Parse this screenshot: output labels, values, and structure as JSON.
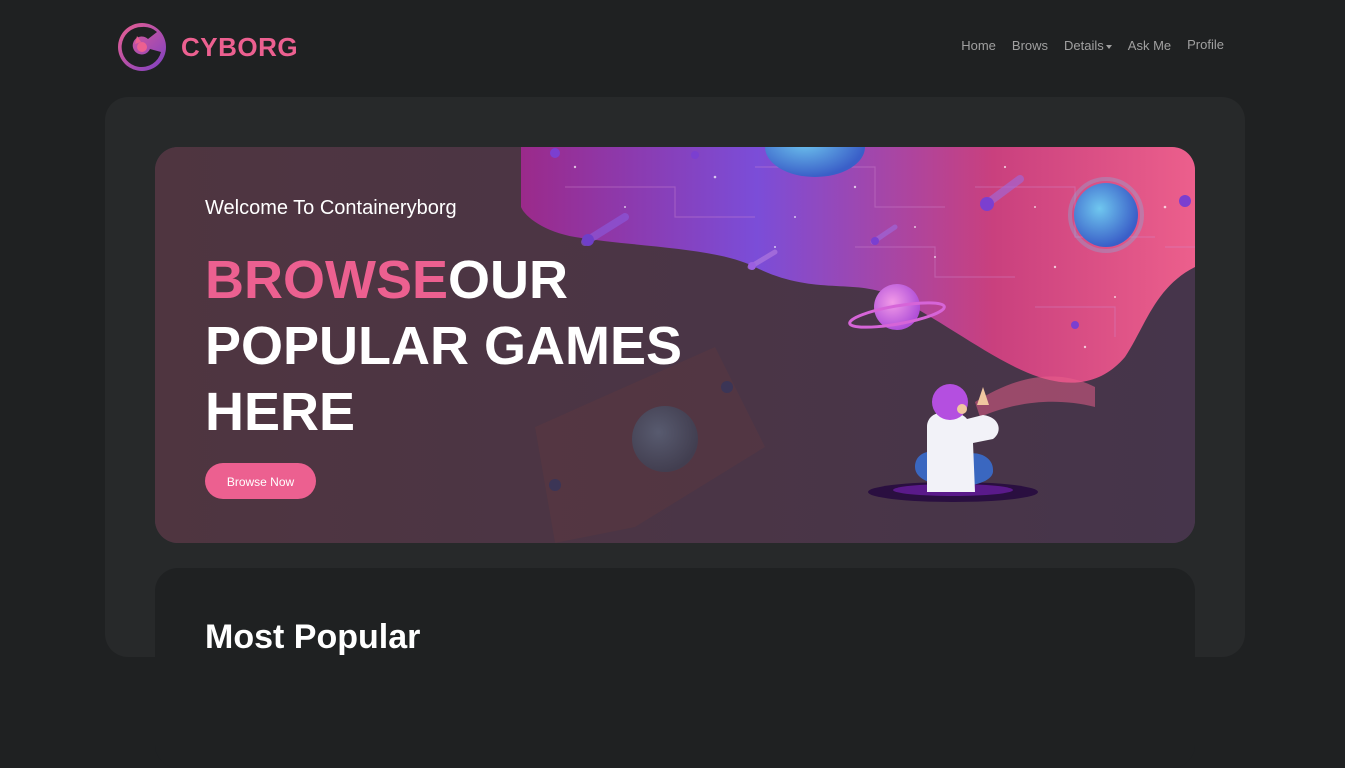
{
  "brand": {
    "name": "CYBORG",
    "accent_color": "#ec6090"
  },
  "nav": {
    "items": [
      {
        "label": "Home"
      },
      {
        "label": "Brows"
      },
      {
        "label": "Details",
        "has_dropdown": true
      },
      {
        "label": "Ask Me"
      },
      {
        "label": "Profile"
      }
    ]
  },
  "banner": {
    "welcome": "Welcome To Containeryborg",
    "title_accent": "BROWSE",
    "title_rest": "OUR POPULAR GAMES HERE",
    "button_label": "Browse Now"
  },
  "popular": {
    "title": "Most Popular"
  }
}
